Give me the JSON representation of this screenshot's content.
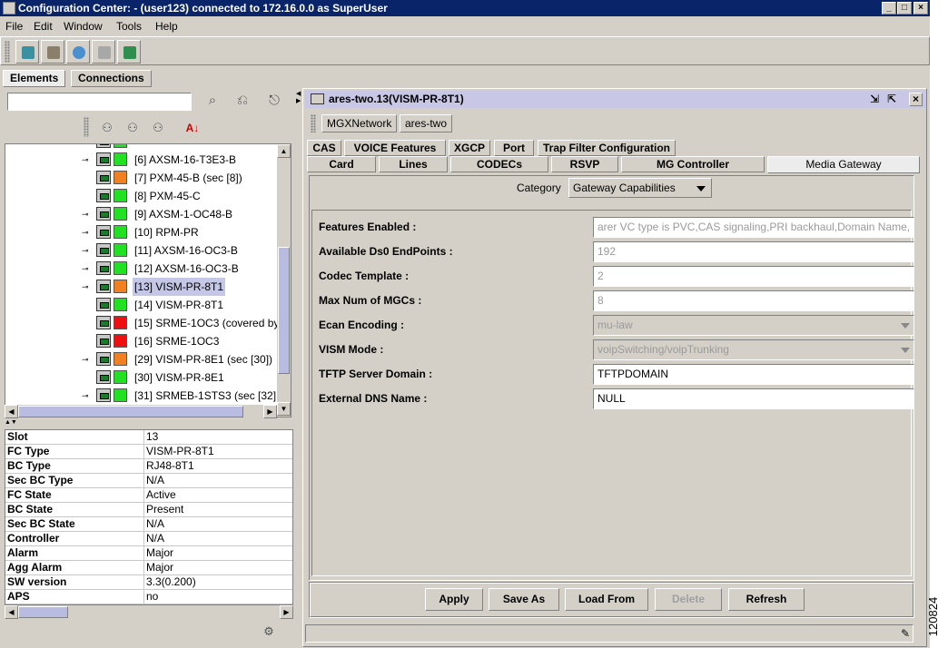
{
  "window": {
    "title": "Configuration Center: - (user123) connected to 172.16.0.0 as SuperUser"
  },
  "menu": [
    "File",
    "Edit",
    "Window",
    "Tools",
    "Help"
  ],
  "top_tabs": [
    "Elements",
    "Connections"
  ],
  "search": {
    "value": ""
  },
  "tree": {
    "rows": [
      {
        "label": "[6] AXSM-16-T3E3-B",
        "expand": true,
        "status": "#22e022"
      },
      {
        "label": "[7] PXM-45-B (sec [8])",
        "expand": false,
        "status": "#f08020"
      },
      {
        "label": "[8] PXM-45-C",
        "expand": false,
        "status": "#22e022"
      },
      {
        "label": "[9] AXSM-1-OC48-B",
        "expand": true,
        "status": "#22e022"
      },
      {
        "label": "[10] RPM-PR",
        "expand": true,
        "status": "#22e022"
      },
      {
        "label": "[11] AXSM-16-OC3-B",
        "expand": true,
        "status": "#22e022"
      },
      {
        "label": "[12] AXSM-16-OC3-B",
        "expand": true,
        "status": "#22e022"
      },
      {
        "label": "[13] VISM-PR-8T1",
        "expand": true,
        "status": "#f08020",
        "selected": true
      },
      {
        "label": "[14] VISM-PR-8T1",
        "expand": false,
        "status": "#22e022"
      },
      {
        "label": "[15] SRME-1OC3 (covered by",
        "expand": false,
        "status": "#ee1010"
      },
      {
        "label": "[16] SRME-1OC3",
        "expand": false,
        "status": "#ee1010"
      },
      {
        "label": "[29] VISM-PR-8E1 (sec [30])",
        "expand": true,
        "status": "#f08020"
      },
      {
        "label": "[30] VISM-PR-8E1",
        "expand": false,
        "status": "#22e022"
      },
      {
        "label": "[31] SRMEB-1STS3 (sec [32]",
        "expand": true,
        "status": "#22e022"
      }
    ]
  },
  "properties": [
    {
      "key": "Slot",
      "value": "13"
    },
    {
      "key": "FC Type",
      "value": "VISM-PR-8T1"
    },
    {
      "key": "BC Type",
      "value": "RJ48-8T1"
    },
    {
      "key": "Sec BC Type",
      "value": "N/A"
    },
    {
      "key": "FC State",
      "value": "Active"
    },
    {
      "key": "BC State",
      "value": "Present"
    },
    {
      "key": "Sec BC State",
      "value": "N/A"
    },
    {
      "key": "Controller",
      "value": "N/A"
    },
    {
      "key": "Alarm",
      "value": "Major"
    },
    {
      "key": "Agg Alarm",
      "value": "Major"
    },
    {
      "key": "SW version",
      "value": "3.3(0.200)"
    },
    {
      "key": "APS",
      "value": "no"
    }
  ],
  "inner_window": {
    "title": "ares-two.13(VISM-PR-8T1)"
  },
  "breadcrumb": [
    "MGXNetwork",
    "ares-two"
  ],
  "tabs_row1": [
    "CAS",
    "VOICE Features",
    "XGCP",
    "Port",
    "Trap Filter Configuration"
  ],
  "tabs_row2": [
    "Card",
    "Lines",
    "CODECs",
    "RSVP",
    "MG Controller",
    "Media Gateway"
  ],
  "category": {
    "label": "Category",
    "value": "Gateway Capabilities"
  },
  "fields": [
    {
      "label": "Features Enabled :",
      "value": "arer VC type is PVC,CAS signaling,PRI backhaul,Domain Name,",
      "readonly": true
    },
    {
      "label": "Available Ds0 EndPoints :",
      "value": "192",
      "readonly": true
    },
    {
      "label": "Codec Template :",
      "value": "2",
      "readonly": true
    },
    {
      "label": "Max Num of MGCs :",
      "value": "8",
      "readonly": true
    },
    {
      "label": "Ecan Encoding :",
      "value": "mu-law",
      "readonly": true,
      "combo": true
    },
    {
      "label": "VISM Mode :",
      "value": "voipSwitching/voipTrunking",
      "readonly": true,
      "combo": true
    },
    {
      "label": "TFTP Server Domain :",
      "value": "TFTPDOMAIN",
      "readonly": false
    },
    {
      "label": "External DNS Name :",
      "value": "NULL",
      "readonly": false
    }
  ],
  "actions": {
    "apply": "Apply",
    "save_as": "Save As",
    "load_from": "Load From",
    "delete": "Delete",
    "refresh": "Refresh"
  },
  "side_label": "120824"
}
